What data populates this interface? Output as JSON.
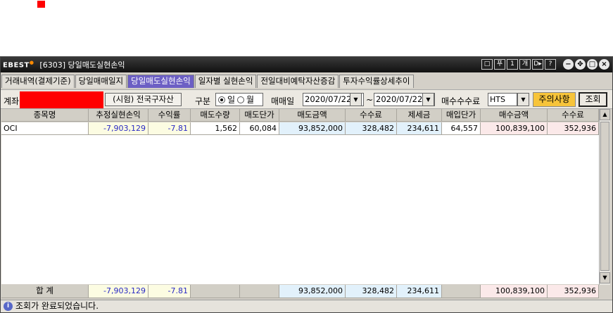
{
  "window": {
    "logo": "EBEST",
    "title": "[6303] 당일매도실현손익",
    "title_buttons": [
      "□",
      "푸",
      "1",
      "개",
      "D▸",
      "?"
    ]
  },
  "tabs": [
    {
      "label": "거래내역(결제기준)",
      "active": false
    },
    {
      "label": "당일매매일지",
      "active": false
    },
    {
      "label": "당일매도실현손익",
      "active": true
    },
    {
      "label": "일자별 실현손익",
      "active": false
    },
    {
      "label": "전일대비예탁자산증감",
      "active": false
    },
    {
      "label": "투자수익률상세추이",
      "active": false
    }
  ],
  "filter": {
    "account_label": "계좌",
    "account_button": "(시험) 전국구자산",
    "type_label": "구분",
    "radio_day": "일",
    "radio_month": "월",
    "date_label": "매매일",
    "date_from": "2020/07/22",
    "tilde": "~",
    "date_to": "2020/07/22",
    "fee_label": "매수수수료",
    "fee_value": "HTS",
    "warning_button": "주의사항",
    "query_button": "조회"
  },
  "table": {
    "columns": [
      "종목명",
      "추정실현손익",
      "수익률",
      "매도수량",
      "매도단가",
      "매도금액",
      "수수료",
      "제세금",
      "매입단가",
      "매수금액",
      "수수료"
    ],
    "rows": [
      [
        "OCI",
        "-7,903,129",
        "-7.81",
        "1,562",
        "60,084",
        "93,852,000",
        "328,482",
        "234,611",
        "64,557",
        "100,839,100",
        "352,936"
      ]
    ],
    "total": [
      "합 계",
      "-7,903,129",
      "-7.81",
      "",
      "",
      "93,852,000",
      "328,482",
      "234,611",
      "",
      "100,839,100",
      "352,936"
    ]
  },
  "status": {
    "message": "조회가 완료되었습니다."
  },
  "colors": {
    "active_tab": "#6c5fc4",
    "warning_button": "#f7c43a",
    "redaction": "#ff0000",
    "col_yellow": "#fcfce2",
    "col_blue": "#e2f1fb",
    "col_pink": "#fbe9e9",
    "negative_text": "#2a2ac4"
  }
}
